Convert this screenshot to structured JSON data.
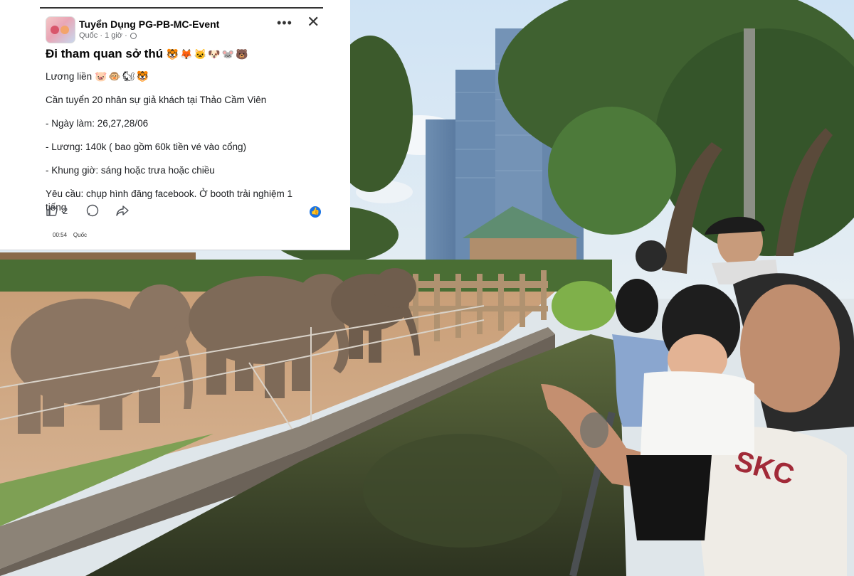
{
  "post": {
    "page_name": "Tuyển Dụng PG-PB-MC-Event",
    "meta_text": "Quốc · 1 giờ ·",
    "more_icon": "more-horizontal-icon",
    "close_icon": "close-icon",
    "headline": "Đi tham quan sở thú",
    "headline_emojis": "🐯🦊🐱🐶🐭🐻",
    "salary_line": "Lương liền",
    "salary_emojis": "🐷🐵🐿🐯",
    "line_recruit": "Cần tuyển 20 nhân sự giả khách tại Thảo Cầm Viên",
    "line_days": "- Ngày làm: 26,27,28/06",
    "line_pay": "- Lương: 140k ( bao gồm 60k tiền vé vào cổng)",
    "line_hours": "- Khung giờ: sáng hoặc trưa hoặc chiều",
    "line_requirement_1": "Yêu cầu: chụp hình đăng facebook. Ở booth trải nghiệm 1",
    "line_requirement_2": "tiếng",
    "like_count": "2",
    "bottom_bar_time": "00:54",
    "bottom_bar_name": "Quốc"
  },
  "icons": {
    "like": "thumbs-up-icon",
    "comment": "comment-icon",
    "share": "share-icon",
    "reaction": "like-reaction-icon"
  },
  "colors": {
    "facebook_blue": "#1b74e4",
    "card_bg": "#ffffff",
    "text": "#050505",
    "secondary_text": "#65676b"
  }
}
